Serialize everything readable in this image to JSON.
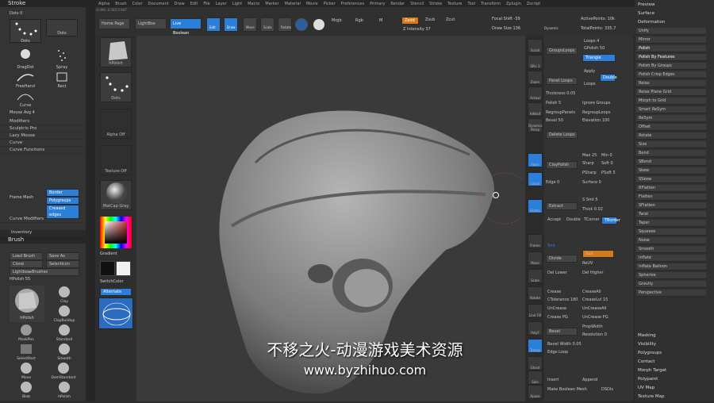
{
  "menu": [
    "Alpha",
    "Brush",
    "Color",
    "Document",
    "Draw",
    "Edit",
    "File",
    "Layer",
    "Light",
    "Macro",
    "Marker",
    "Material",
    "Movie",
    "Picker",
    "Preferences",
    "Primary",
    "Render",
    "Stencil",
    "Stroke",
    "Texture",
    "Tool",
    "Transform",
    "Zplugin",
    "Zscript"
  ],
  "stroke": {
    "title": "Stroke",
    "dots_label": "Dots",
    "dots_val": "0",
    "items": [
      "Dots",
      "Dots",
      "DragDot",
      "Spray",
      "FreeHand",
      "Rect",
      "Curve"
    ],
    "mouse_avg": "Mouse Avg 4",
    "rows": [
      "Modifiers",
      "Sculptris Pro",
      "Lazy Mouse",
      "Curve",
      "Curve Functions"
    ],
    "frame_mesh": "Frame Mesh",
    "border": "Border",
    "polygroups": "Polygroups",
    "creased": "Creased edges",
    "curve_modifiers": "Curve Modifiers",
    "inventory": "Inventory"
  },
  "brush": {
    "title": "Brush",
    "load": "Load Brush",
    "save": "Save As",
    "clone": "Clone",
    "select_icon": "SelectIcon",
    "lightbox": "Lightbox▸Brushes",
    "hpolish_val": "HPolish 55",
    "brushes": [
      "hPolish",
      "Clay",
      "ClayBuildup",
      "MaskPen",
      "Standard",
      "SelectRect",
      "Smooth",
      "Move",
      "DamStandard",
      "Blob",
      "hPolish"
    ]
  },
  "top": {
    "homepage": "Home Page",
    "lightbox": "LightBox",
    "liveboolean": "Live Boolean",
    "edit": "Edit",
    "draw": "Draw",
    "move": "Move",
    "scale": "Scale",
    "rotate": "Rotate",
    "mrgb": "Mrgb",
    "rgb": "Rgb",
    "m": "M",
    "zadd": "Zadd",
    "zsub": "Zsub",
    "zcut": "Zcut",
    "z_intensity": "Z Intensity 37",
    "focal_shift": "Focal Shift -39",
    "draw_size": "Draw Size 136",
    "dynamic": "Dynamic",
    "active_points": "ActivePoints: 10k",
    "total_points": "TotalPoints: 335.7",
    "coords": "-0.096,-0.585,0.967"
  },
  "midcol": [
    "hPolish",
    "Dots",
    "Alpha Off",
    "Texture Off",
    "MatCap Gray",
    "Gradient",
    "SwitchColor",
    "Alternate"
  ],
  "rightstrip": [
    "Scroll",
    "SPix 3",
    "Zoom",
    "Actual",
    "AAHalf",
    "Dynamic Persp",
    "Floor",
    "Local",
    "Gizmo",
    "Frame",
    "Move",
    "Scale",
    "Rotate",
    "Line Fill",
    "PolyF",
    "Transp",
    "Ghost",
    "Solo",
    "Xpose"
  ],
  "geom": {
    "grouploops": "GroupsLoops",
    "loops": "Loops 4",
    "gpolish": "GPolish 50",
    "triangle": "Triangle",
    "apply": "Apply",
    "double": "Double",
    "panel_loops": "Panel Loops",
    "loops2": "Loops",
    "thickness": "Thickness 0.05",
    "polish": "Polish 5",
    "ignore_groups": "Ignore Groups",
    "regroup_panels": "RegroupPanels",
    "regroup_loops": "RegroupLoops",
    "bevel": "Bevel 50",
    "elevation": "Elevation 100",
    "delete_loops": "Delete Loops",
    "claypolish": "ClayPolish",
    "max": "Max 25",
    "min": "Min 0",
    "sharp": "Sharp",
    "soft": "Soft 0",
    "psharp": "PSharp",
    "psoft": "PSoft 5",
    "edge": "Edge 0",
    "surface": "Surface 0",
    "extract": "Extract",
    "ssmt": "S Smt 5",
    "thick": "Thick 0.02",
    "accept": "Accept",
    "tcorner": "TCorner",
    "tborder": "TBorder",
    "divide": "Divide",
    "suv": "Suv",
    "reuv": "ReUV",
    "crease": "Crease",
    "crease_all": "CreaseAll",
    "ctolerance": "CTolerance 180",
    "crease_lvl": "CreaseLvl 15",
    "uncrease": "UnCrease",
    "uncrease_all": "UnCreaseAll",
    "crease_pg": "Crease PG",
    "uncrease_pg": "UnCrease PG",
    "bevel2": "Bevel",
    "propwidth": "PropWidth",
    "resolution": "Resolution 0",
    "bevel_width": "Bevel Width 0.05",
    "insert": "Insert",
    "append": "Append",
    "make_boolean": "Make Boolean Mesh",
    "dsdiv": "DSDiv",
    "smt": "Smt",
    "edge_loop": "Edge Loop",
    "del_lower": "Del Lower",
    "del_higher": "Del Higher"
  },
  "deform": {
    "preview": "Preview",
    "surface": "Surface",
    "deformation": "Deformation",
    "rows": [
      "Unify",
      "Mirror",
      "Polish",
      "Polish By Features",
      "Polish By Groups",
      "Polish Crisp Edges",
      "Relax",
      "Relax Plane Grid",
      "Morph to Grid",
      "Smart ReSym",
      "ReSym",
      "Offset",
      "Rotate",
      "Size",
      "Bend",
      "SBend",
      "Skew",
      "SSkew",
      "RFlatten",
      "Flatten",
      "SFlatten",
      "Twist",
      "Taper",
      "Squeeze",
      "Noise",
      "Smooth",
      "Inflate",
      "Inflate Balloon",
      "Spherize",
      "Gravity",
      "Perspective"
    ],
    "bottom": [
      "Masking",
      "Visibility",
      "Polygroups",
      "Contact",
      "Morph Target",
      "Polypaint",
      "UV Map",
      "Texture Map"
    ]
  },
  "watermark": {
    "line1": "不移之火-动漫游戏美术资源",
    "line2": "www.byzhihuo.com"
  },
  "colors": {
    "accent": "#2c7fd9",
    "orange": "#d47a1c"
  }
}
